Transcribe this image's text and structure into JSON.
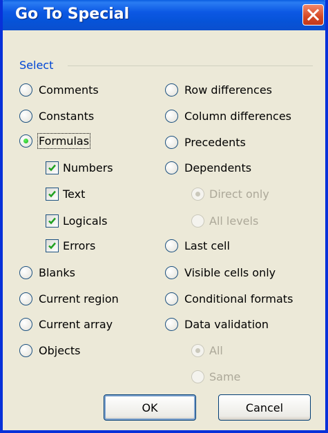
{
  "window": {
    "title": "Go To Special"
  },
  "group": {
    "label": "Select"
  },
  "options": {
    "comments": "Comments",
    "constants": "Constants",
    "formulas": "Formulas",
    "numbers": "Numbers",
    "text": "Text",
    "logicals": "Logicals",
    "errors": "Errors",
    "blanks": "Blanks",
    "current_region": "Current region",
    "current_array": "Current array",
    "objects": "Objects",
    "row_differences": "Row differences",
    "column_differences": "Column differences",
    "precedents": "Precedents",
    "dependents": "Dependents",
    "direct_only": "Direct only",
    "all_levels": "All levels",
    "last_cell": "Last cell",
    "visible_cells_only": "Visible cells only",
    "conditional_formats": "Conditional formats",
    "data_validation": "Data validation",
    "all": "All",
    "same": "Same"
  },
  "state": {
    "selected_option": "Formulas",
    "checked": [
      "Numbers",
      "Text",
      "Logicals",
      "Errors"
    ]
  },
  "buttons": {
    "ok": "OK",
    "cancel": "Cancel"
  },
  "icons": {
    "close": "close-icon",
    "check": "checkmark-icon"
  },
  "colors": {
    "title_bar": "#0653d8",
    "close": "#d54924",
    "group_label": "#0046d5",
    "dialog_bg": "#ece9d8"
  }
}
